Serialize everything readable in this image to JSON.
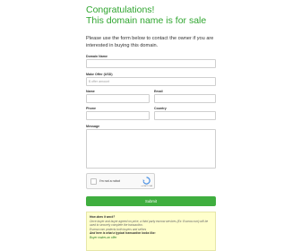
{
  "header": {
    "title_line1": "Congratulations!",
    "title_line2": "This domain name is for sale"
  },
  "intro": "Please use the form below to contact the owner if you are interested in buying this domain.",
  "form": {
    "domain_label": "Domain Name",
    "domain_value": "",
    "offer_label": "Make Offer (USD)",
    "offer_placeholder": "$ offer amount",
    "name_label": "Name",
    "email_label": "Email",
    "phone_label": "Phone",
    "country_label": "Country",
    "message_label": "Message"
  },
  "captcha": {
    "label": "I'm not a robot",
    "brand": "reCAPTCHA"
  },
  "submit_label": "Submit",
  "info": {
    "q1": "How does it work?",
    "a1": "Once buyer and buyer agreed on price, a third party escrow services (Ex: Escrow.com) will be used to securely complete the transaction.",
    "a1b": "Escrow.com protects both buyers and sellers",
    "q2": "And here is what a typical transaction looks like:",
    "li1": "Buyer makes an offer"
  }
}
